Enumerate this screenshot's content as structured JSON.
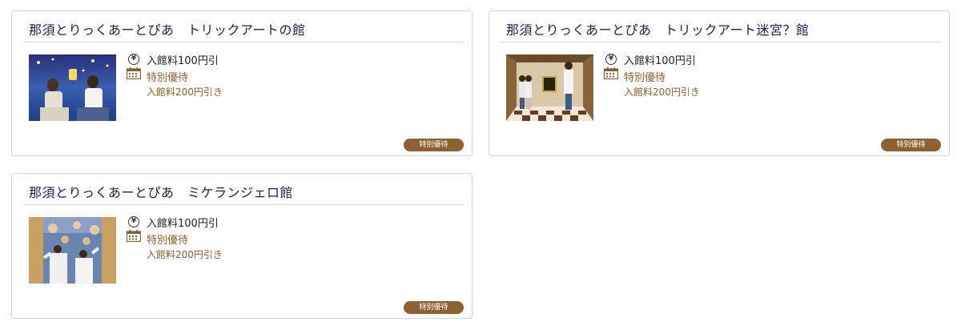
{
  "cards": [
    {
      "title": "那須とりっくあーとぴあ　トリックアートの館",
      "discount": "入館料100円引",
      "special_label": "特別優待",
      "special_detail": "入館料200円引き",
      "badge": "特別優待"
    },
    {
      "title": "那須とりっくあーとぴあ　トリックアート迷宮？館",
      "discount": "入館料100円引",
      "special_label": "特別優待",
      "special_detail": "入館料200円引き",
      "badge": "特別優待"
    },
    {
      "title": "那須とりっくあーとぴあ　ミケランジェロ館",
      "discount": "入館料100円引",
      "special_label": "特別優待",
      "special_detail": "入館料200円引き",
      "badge": "特別優待"
    }
  ],
  "icons": {
    "yen": "yen-icon",
    "calendar": "calendar-icon"
  },
  "colors": {
    "title": "#1f1c4a",
    "accent": "#8a5f2c",
    "badge_bg": "#8f6130",
    "border": "#d4d4d4"
  }
}
